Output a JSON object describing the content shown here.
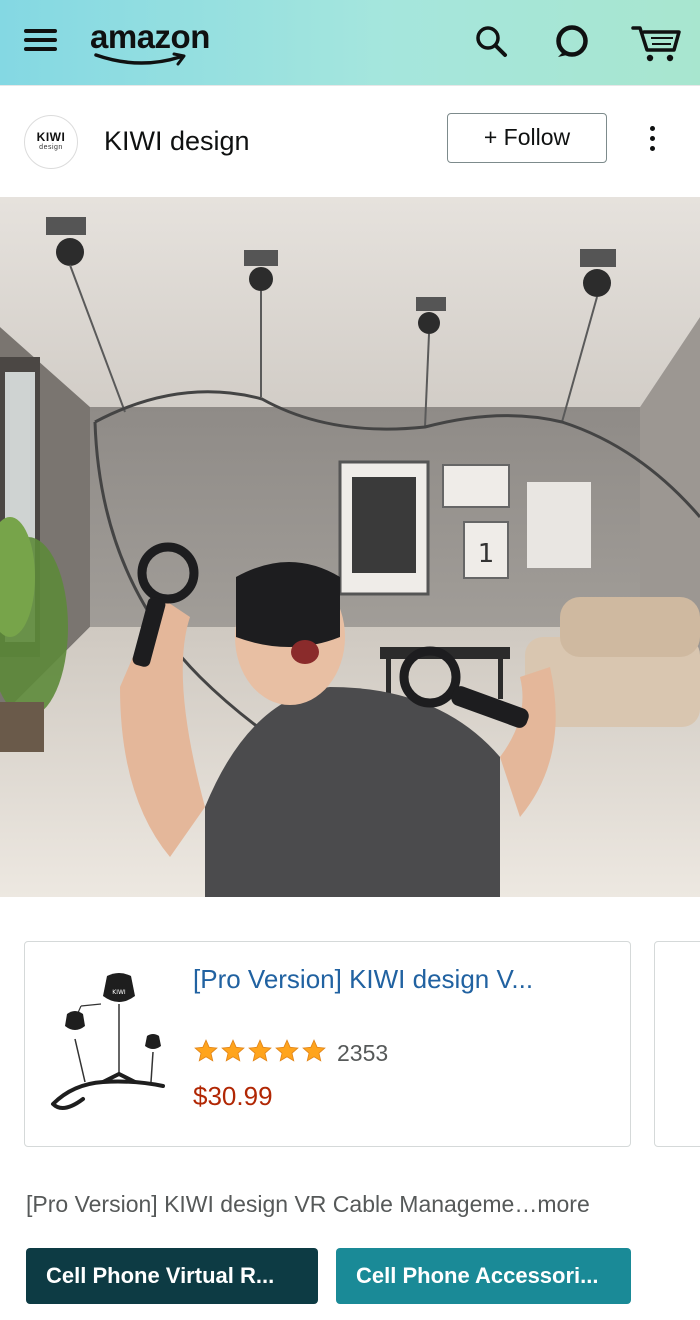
{
  "header": {
    "logo_text": "amazon",
    "icons": [
      "hamburger-menu-icon",
      "search-icon",
      "alexa-icon",
      "cart-icon"
    ],
    "gradient": [
      "#84d8e3",
      "#a8e6cf"
    ]
  },
  "brand": {
    "logo_line1": "KIWI",
    "logo_line2": "design",
    "name": "KIWI design",
    "follow_label": "+ Follow"
  },
  "product": {
    "title": "[Pro Version] KIWI design V...",
    "rating_stars": 5,
    "rating_count": "2353",
    "price": "$30.99"
  },
  "description": {
    "text": "[Pro Version] KIWI design VR Cable Manageme…",
    "more_label": "more"
  },
  "chips": [
    {
      "label": "Cell Phone Virtual R...",
      "color": "#0d3b44"
    },
    {
      "label": "Cell Phone Accessori...",
      "color": "#1a8a97"
    }
  ],
  "colors": {
    "link": "#2162a1",
    "price": "#b12704",
    "star": "#ffa41c"
  }
}
